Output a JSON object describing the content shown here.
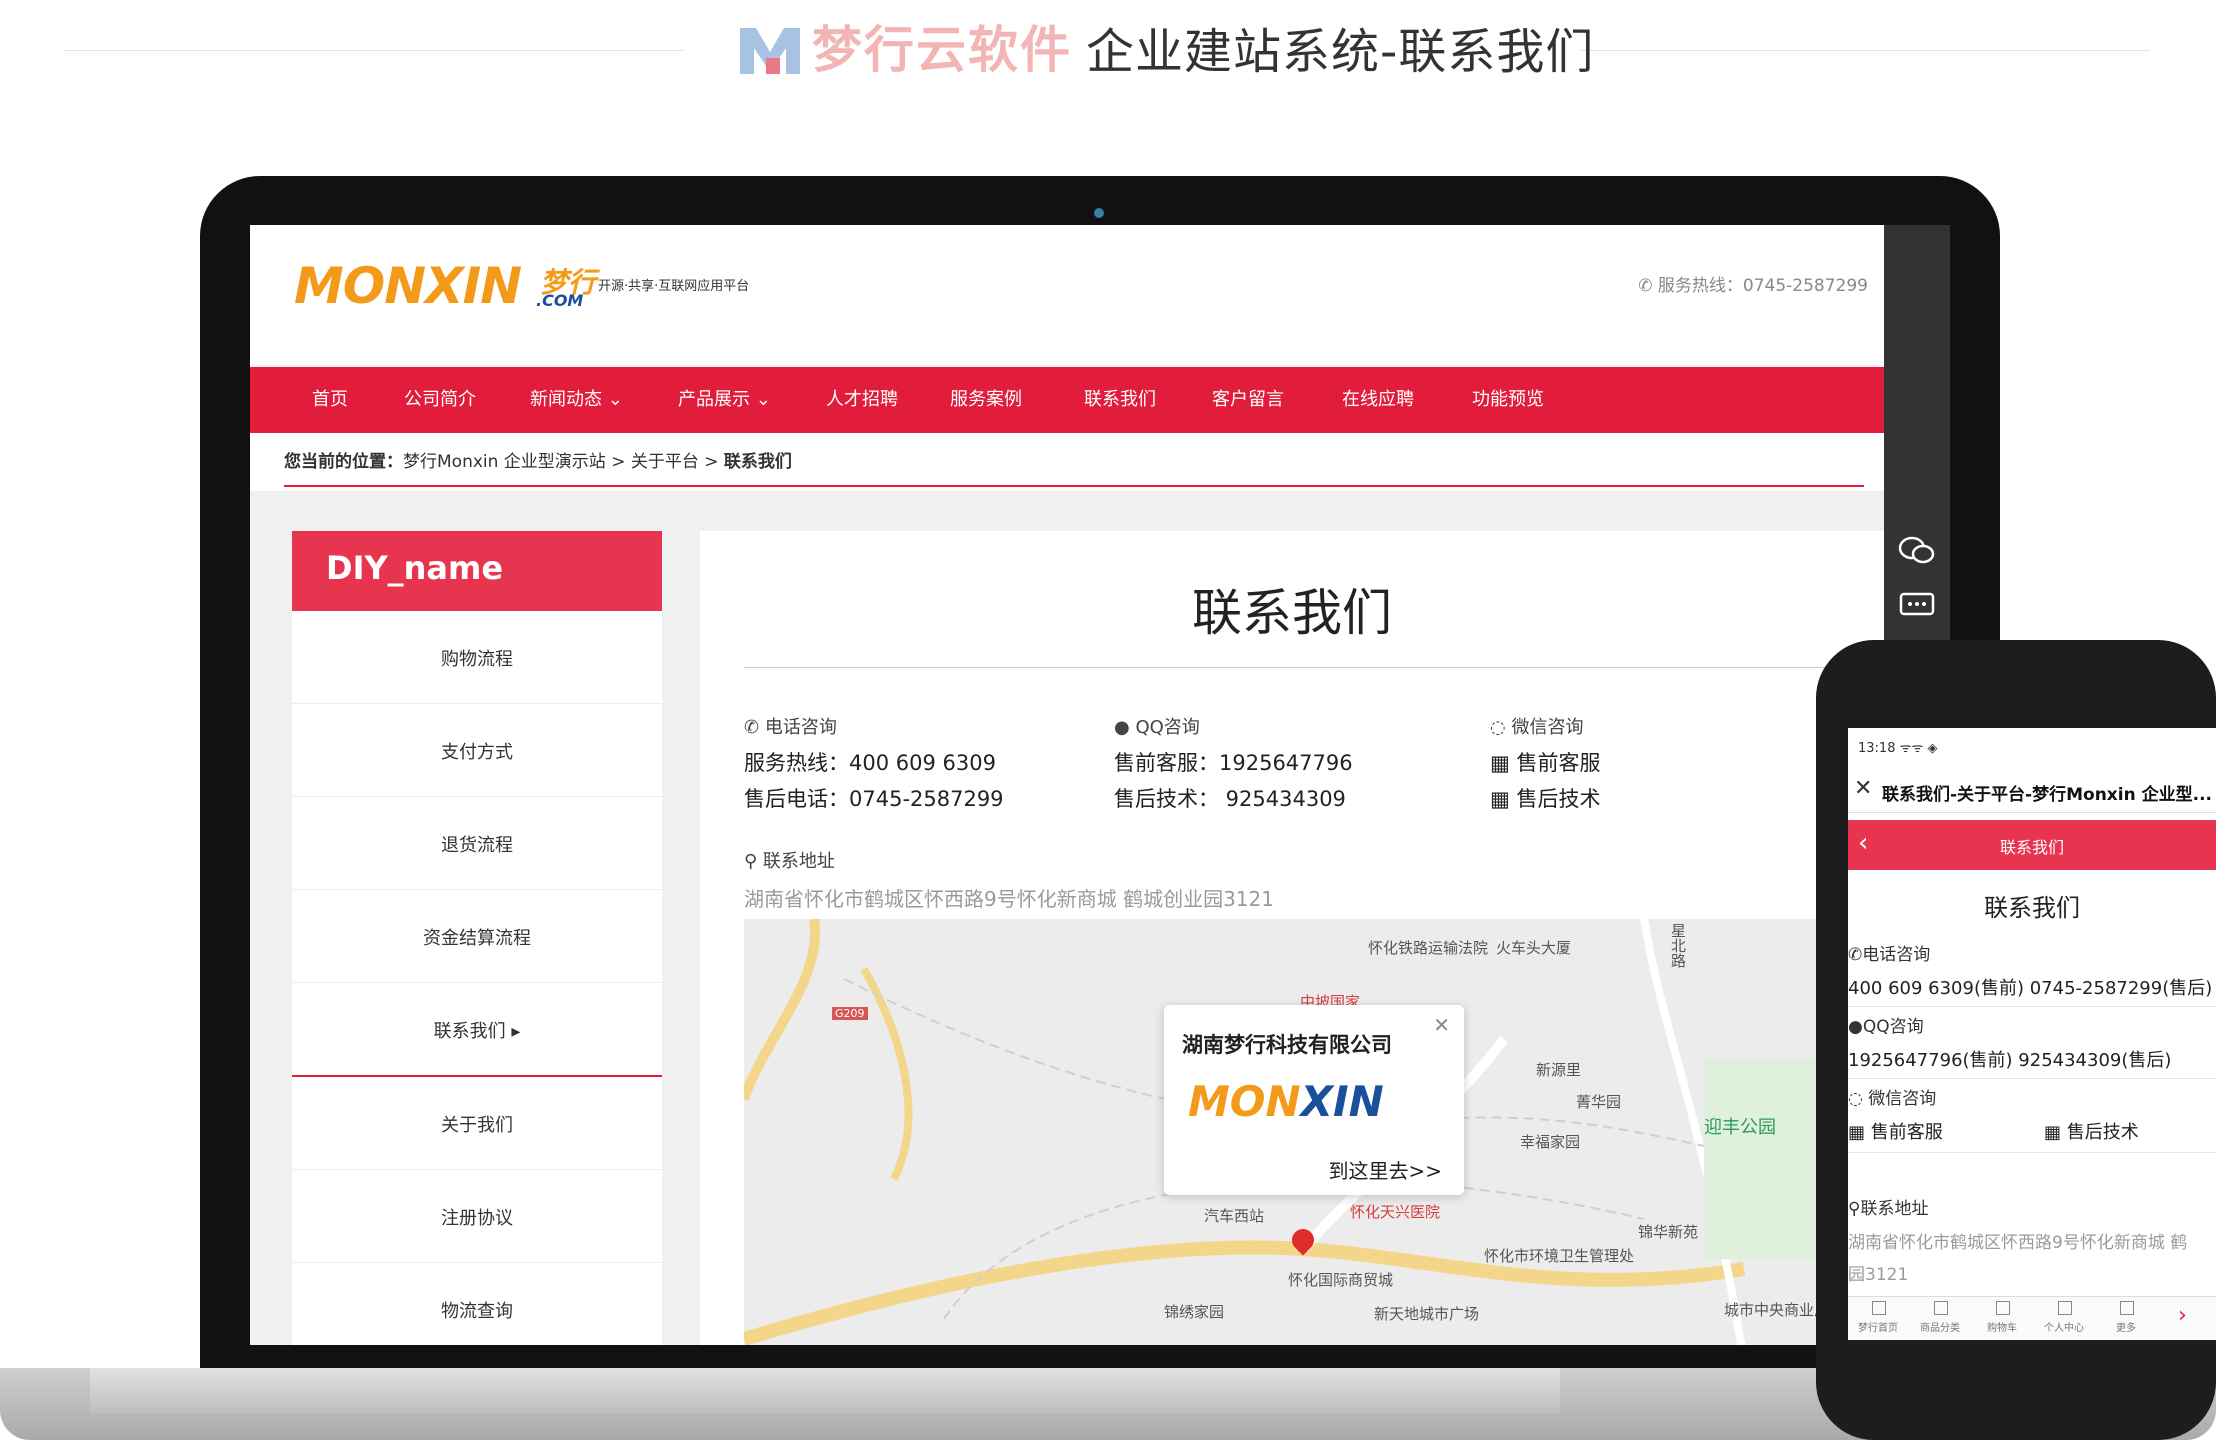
{
  "banner": {
    "brand_name": "梦行云软件",
    "title": "企业建站系统-联系我们"
  },
  "site": {
    "logo_text_main": "MONXIN",
    "logo_text_cn": "梦行",
    "logo_text_com": ".COM",
    "slogan": "开源·共享·互联网应用平台",
    "hotline": "服务热线：0745-2587299",
    "nav": [
      "首页",
      "公司简介",
      "新闻动态 ⌄",
      "产品展示 ⌄",
      "人才招聘",
      "服务案例",
      "联系我们",
      "客户留言",
      "在线应聘",
      "功能预览"
    ],
    "breadcrumb": {
      "prefix": "您当前的位置：",
      "path": "梦行Monxin 企业型演示站 > 关于平台 > ",
      "current": "联系我们"
    }
  },
  "sidebar": {
    "title": "DIY_name",
    "items": [
      "购物流程",
      "支付方式",
      "退货流程",
      "资金结算流程",
      "联系我们 ▸",
      "关于我们",
      "注册协议",
      "物流查询"
    ]
  },
  "content": {
    "title": "联系我们",
    "phone_label": "电话咨询",
    "hotline": "服务热线：400 609 6309",
    "after_sale_phone": "售后电话：0745-2587299",
    "qq_label": "QQ咨询",
    "qq_presale": "售前客服：1925647796",
    "qq_tech": "售后技术：  925434309",
    "wechat_label": "微信咨询",
    "wechat_presale": "售前客服",
    "wechat_tech": "售后技术",
    "address_label": "联系地址",
    "address": "湖南省怀化市鹤城区怀西路9号怀化新商城 鹤城创业园3121"
  },
  "map": {
    "popup_title": "湖南梦行科技有限公司",
    "popup_go": "到这里去>>",
    "labels": [
      "怀化铁路运输法院",
      "火车头大厦",
      "中坡国家",
      "新源里",
      "菁华园",
      "幸福家园",
      "迎丰公园",
      "汽车西站",
      "怀化天兴医院",
      "怀化国际商贸城",
      "怀化市环境卫生管理处",
      "锦华新苑",
      "锦绣家园",
      "新天地城市广场",
      "城市中央商业广场",
      "G209",
      "星北路"
    ]
  },
  "phone": {
    "status": "13:18 ᯤᯤ ◈",
    "window_title": "联系我们-关于平台-梦行Monxin 企业型...",
    "header": "联系我们",
    "page_title": "联系我们",
    "phone_label": "电话咨询",
    "phone_value": "400 609 6309(售前)   0745-2587299(售后)",
    "qq_label": "QQ咨询",
    "qq_value": "1925647796(售前)   925434309(售后)",
    "wechat_label": "微信咨询",
    "wechat_presale": "售前客服",
    "wechat_tech": "售后技术",
    "address_label": "联系地址",
    "address_line1": "湖南省怀化市鹤城区怀西路9号怀化新商城 鹤",
    "address_line2": "园3121",
    "tabs": [
      "梦行首页",
      "商品分类",
      "购物车",
      "个人中心",
      "更多"
    ]
  },
  "colors": {
    "nav_red": "#e21d3b",
    "sidebar_red": "#e73550",
    "logo_orange": "#f39a1b",
    "logo_blue": "#1b4f9c"
  }
}
